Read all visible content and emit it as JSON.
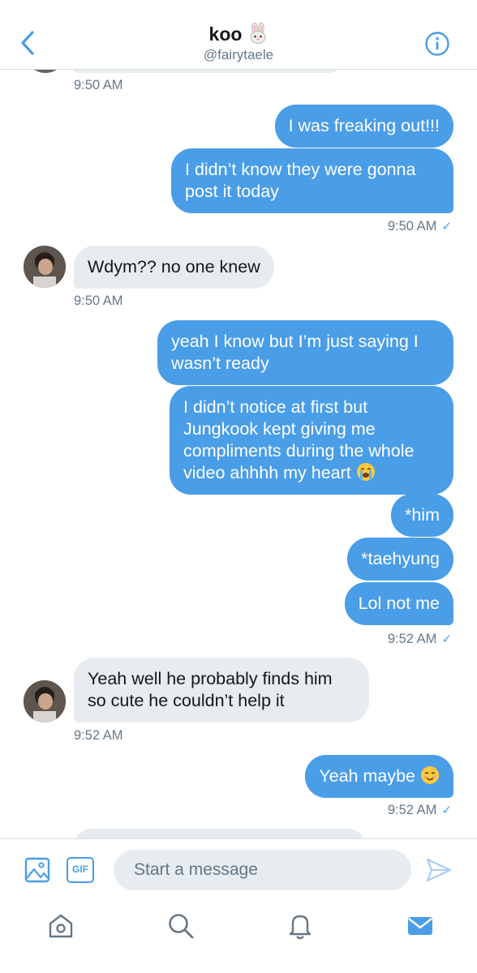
{
  "header": {
    "name": "koo",
    "handle": "@fairytaele",
    "name_emoji": "rabbit-face"
  },
  "messages": [
    {
      "side": "in",
      "text": "",
      "partial": true
    },
    {
      "side": "ts",
      "text": "9:50 AM"
    },
    {
      "side": "out",
      "text": "I was freaking out!!!"
    },
    {
      "side": "out",
      "text": "I didn’t know they were gonna post it today"
    },
    {
      "side": "ts",
      "text": "9:50 AM",
      "read": true
    },
    {
      "side": "in",
      "text": "Wdym?? no one knew"
    },
    {
      "side": "ts",
      "text": "9:50 AM"
    },
    {
      "side": "out",
      "text": "yeah I know but I’m just saying I wasn’t ready"
    },
    {
      "side": "out",
      "text": "I didn’t notice at first but Jungkook kept giving me compliments during the whole video ahhhh my heart",
      "emoji": "loudly-crying-face"
    },
    {
      "side": "out",
      "text": "*him"
    },
    {
      "side": "out",
      "text": "*taehyung"
    },
    {
      "side": "out",
      "text": "Lol not me"
    },
    {
      "side": "ts",
      "text": "9:52 AM",
      "read": true
    },
    {
      "side": "in",
      "text": "Yeah well he probably finds him so cute he couldn’t help it"
    },
    {
      "side": "ts",
      "text": "9:52 AM"
    },
    {
      "side": "out",
      "text": "Yeah maybe",
      "emoji": "smiling-face"
    },
    {
      "side": "ts",
      "text": "9:52 AM",
      "read": true
    }
  ],
  "composer": {
    "placeholder": "Start a message",
    "gif_label": "GIF"
  },
  "tabs": [
    "home-icon",
    "search-icon",
    "notifications-icon",
    "messages-icon"
  ],
  "colors": {
    "accent": "#4a9de7",
    "incoming_bubble": "#e6ecf0",
    "secondary_text": "#657786"
  }
}
